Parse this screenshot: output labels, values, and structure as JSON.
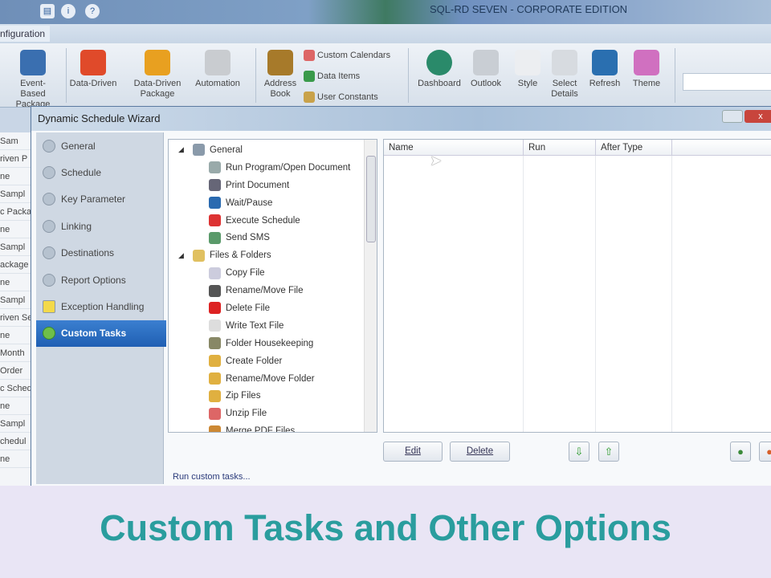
{
  "app": {
    "title": "SQL-RD SEVEN - CORPORATE EDITION",
    "ribbon_tab": "nfiguration"
  },
  "ribbon": {
    "buttons": [
      {
        "label": "Event-Based Package",
        "icon": "network-icon",
        "color": "#3a6fb0"
      },
      {
        "label": "Data-Driven",
        "icon": "data-driven-icon",
        "color": "#e04a2a"
      },
      {
        "label": "Data-Driven Package",
        "icon": "package-icon",
        "color": "#e8a020"
      },
      {
        "label": "Automation",
        "icon": "gear-doc-icon",
        "color": "#c9ccd0"
      },
      {
        "label": "Address Book",
        "icon": "book-icon",
        "color": "#a77a2a"
      }
    ],
    "small": [
      {
        "label": "Custom Calendars",
        "icon": "calendar-icon",
        "color": "#d66"
      },
      {
        "label": "Data Items",
        "icon": "data-items-icon",
        "color": "#3a9a4a"
      },
      {
        "label": "User Constants",
        "icon": "user-icon",
        "color": "#c9a24a"
      }
    ],
    "right": [
      {
        "label": "Dashboard",
        "icon": "dashboard-icon",
        "color": "#2a8a6a"
      },
      {
        "label": "Outlook",
        "icon": "outlook-icon",
        "color": "#c9ced4"
      },
      {
        "label": "Style",
        "icon": "style-icon",
        "color": "#eceef1"
      },
      {
        "label": "Select Details",
        "icon": "details-icon",
        "color": "#d7dbe0"
      },
      {
        "label": "Refresh",
        "icon": "refresh-icon",
        "color": "#2a6fb0"
      },
      {
        "label": "Theme",
        "icon": "theme-icon",
        "color": "#d070c0"
      }
    ]
  },
  "background_list": [
    "Sam",
    "riven P",
    "ne",
    "Sampl",
    "c Packa",
    "ne",
    "Sampl",
    "ackage",
    "ne",
    "Sampl",
    "riven Se",
    "ne",
    "Month",
    "Order",
    "c Sched",
    "ne",
    "Sampl",
    "chedul",
    "ne"
  ],
  "dialog": {
    "title": "Dynamic Schedule Wizard",
    "close": "x",
    "nav": [
      {
        "label": "General",
        "icon": "info-icon"
      },
      {
        "label": "Schedule",
        "icon": "clock-icon"
      },
      {
        "label": "Key Parameter",
        "icon": "key-icon"
      },
      {
        "label": "Linking",
        "icon": "link-icon"
      },
      {
        "label": "Destinations",
        "icon": "destinations-icon"
      },
      {
        "label": "Report Options",
        "icon": "report-options-icon"
      },
      {
        "label": "Exception Handling",
        "icon": "warning-icon"
      },
      {
        "label": "Custom Tasks",
        "icon": "custom-tasks-icon",
        "selected": true
      }
    ],
    "tree": [
      {
        "label": "General",
        "group": true,
        "icon": "globe-icon",
        "color": "#8a9aaa"
      },
      {
        "label": "Run Program/Open Document",
        "icon": "run-icon",
        "color": "#9aa"
      },
      {
        "label": "Print Document",
        "icon": "print-icon",
        "color": "#667"
      },
      {
        "label": "Wait/Pause",
        "icon": "pause-icon",
        "color": "#2a6ab0"
      },
      {
        "label": "Execute Schedule",
        "icon": "execute-icon",
        "color": "#d33"
      },
      {
        "label": "Send SMS",
        "icon": "sms-icon",
        "color": "#5a9a6a"
      },
      {
        "label": "Files & Folders",
        "group": true,
        "icon": "folder-icon",
        "color": "#e0c060"
      },
      {
        "label": "Copy File",
        "icon": "copy-icon",
        "color": "#ccd"
      },
      {
        "label": "Rename/Move File",
        "icon": "rename-file-icon",
        "color": "#555"
      },
      {
        "label": "Delete File",
        "icon": "delete-icon",
        "color": "#d22"
      },
      {
        "label": "Write Text File",
        "icon": "text-file-icon",
        "color": "#ddd"
      },
      {
        "label": "Folder Housekeeping",
        "icon": "housekeeping-icon",
        "color": "#886"
      },
      {
        "label": "Create Folder",
        "icon": "create-folder-icon",
        "color": "#e0b040"
      },
      {
        "label": "Rename/Move Folder",
        "icon": "rename-folder-icon",
        "color": "#e0b040"
      },
      {
        "label": "Zip Files",
        "icon": "zip-icon",
        "color": "#e0b040"
      },
      {
        "label": "Unzip File",
        "icon": "unzip-icon",
        "color": "#d66"
      },
      {
        "label": "Merge PDF Files",
        "icon": "pdf-icon",
        "color": "#c83"
      }
    ],
    "grid_headers": [
      "Name",
      "Run",
      "After Type"
    ],
    "buttons": {
      "edit": "Edit",
      "delete": "Delete",
      "down": "⇩",
      "up": "⇧"
    },
    "status": "Run custom tasks..."
  },
  "caption": "Custom Tasks and Other Options"
}
